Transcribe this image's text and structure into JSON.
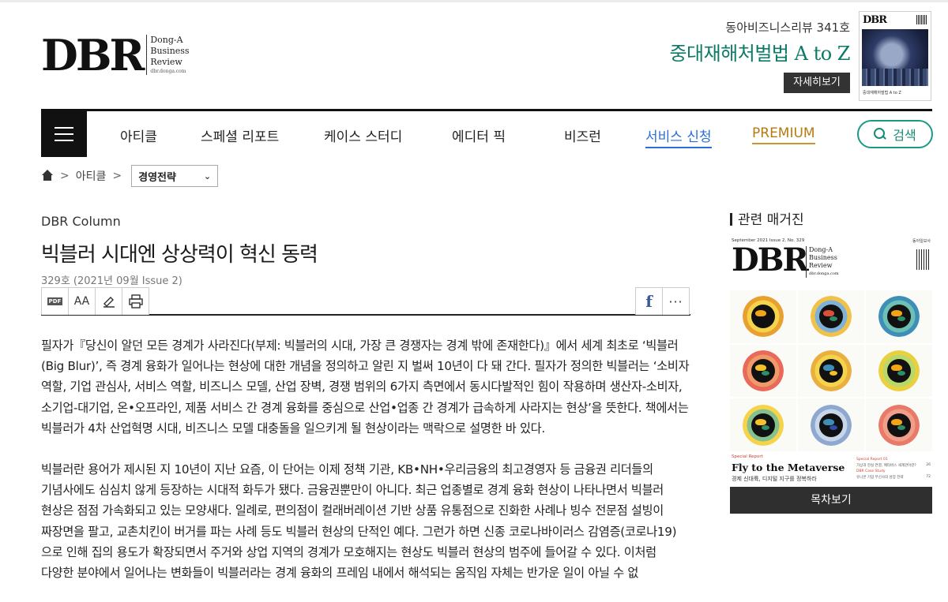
{
  "header": {
    "logo": "DBR",
    "logo_sub": [
      "Dong-A",
      "Business",
      "Review"
    ],
    "logo_domain": "dbr.donga.com",
    "issue_label": "동아비즈니스리뷰 341호",
    "issue_title": "중대재해처벌법 A to Z",
    "detail_button": "자세히보기",
    "cover": {
      "logo": "DBR",
      "caption": "중대재해처벌법 A to Z"
    }
  },
  "nav": {
    "items": [
      "아티클",
      "스페셜 리포트",
      "케이스 스터디",
      "에디터 픽",
      "비즈런"
    ],
    "service": "서비스 신청",
    "premium": "PREMIUM",
    "search": "검색"
  },
  "breadcrumb": {
    "level1": "아티클",
    "selected": "경영전략"
  },
  "article": {
    "column": "DBR Column",
    "title": "빅블러 시대엔 상상력이 혁신 동력",
    "meta": "329호 (2021년 09월 Issue 2)",
    "tools": {
      "pdf": "PDF",
      "font": "AA",
      "facebook": "f",
      "more": "···"
    },
    "paragraphs": [
      "필자가『당신이 알던 모든 경계가 사라진다(부제: 빅블러의 시대, 가장 큰 경쟁자는 경계 밖에 존재한다)』에서 세계 최초로 ‘빅블러(Big Blur)’, 즉 경계 융화가 일어나는 현상에 대한 개념을 정의하고 알린 지 벌써 10년이 다 돼 간다. 필자가 정의한 빅블러는 ‘소비자 역할, 기업 관심사, 서비스 역할, 비즈니스 모델, 산업 장벽, 경쟁 범위의 6가지 측면에서 동시다발적인 힘이 작용하며 생산자-소비자, 소기업-대기업, 온•오프라인, 제품 서비스 간 경계 융화를 중심으로 산업•업종 간 경계가 급속하게 사라지는 현상’을 뜻한다. 책에서는 빅블러가 4차 산업혁명 시대, 비즈니스 모델 대충돌을 일으키게 될 현상이라는 맥락으로 설명한 바 있다.",
      "빅블러란 용어가 제시된 지 10년이 지난 요즘, 이 단어는 이제 정책 기관, KB•NH•우리금융의 최고경영자 등 금융권 리더들의 기념사에도 심심치 않게 등장하는 시대적 화두가 됐다. 금융권뿐만이 아니다. 최근 업종별로 경계 융화 현상이 나타나면서 빅블러 현상은 점점 가속화되고 있는 모양새다. 일례로, 편의점이 컬래버레이션 기반 상품 유통점으로 진화한 사례나 빙수 전문점 설빙이 짜장면을 팔고, 교촌치킨이 버거를 파는 사례 등도 빅블러 현상의 단적인 예다. 그런가 하면 신종 코로나바이러스 감염증(코로나19)으로 인해 집의 용도가 확장되면서 주거와 상업 지역의 경계가 모호해지는 현상도 빅블러 현상의 범주에 들어갈 수 있다. 이처럼 다양한 분야에서 일어나는 변화들이 빅블러라는 경계 융화의 프레임 내에서 해석되는 움직임 자체는 반가운 일이 아닐 수 없"
    ]
  },
  "sidebar": {
    "title": "관련 매거진",
    "magazine": {
      "issue_line": "September 2021 Issue 2, No. 329",
      "publisher": "동아일보사",
      "logo": "DBR",
      "logo_sub": [
        "Dong-A",
        "Business",
        "Review"
      ],
      "domain": "dbr.donga.com",
      "special_label": "Special Report",
      "headline": "Fly to the Metaverse",
      "subline": "경제 신대륙, 디지털 지구를 정복하라",
      "right_items": [
        {
          "label": "Special Report 01",
          "page": ""
        },
        {
          "label": "가상과 현실 연결, 메타버스 세계관이란?",
          "page": "26"
        },
        {
          "label": "DBR Case Study",
          "page": ""
        },
        {
          "label": "유니콘 기업 무신사의 성장 전략",
          "page": "72"
        }
      ]
    },
    "toc_button": "목차보기"
  },
  "colors": {
    "accent_green": "#0d7a68",
    "search_teal": "#1a9a86",
    "service_blue": "#2b6fd6",
    "premium_gold": "#b77a10"
  },
  "icons": [
    "menu-icon",
    "search-icon",
    "home-icon",
    "chevron-right-icon",
    "chevron-down-icon",
    "pdf-icon",
    "font-size-icon",
    "scrap-icon",
    "print-icon",
    "facebook-icon",
    "more-icon"
  ]
}
